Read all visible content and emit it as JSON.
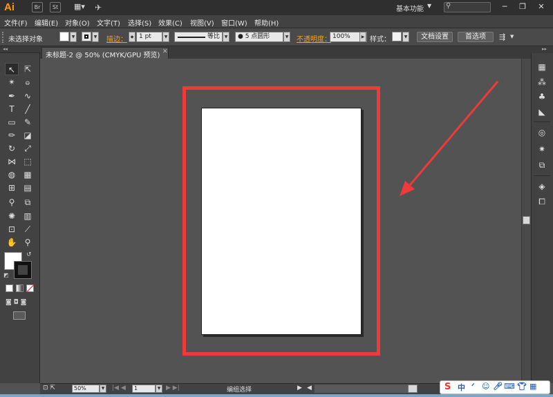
{
  "app": {
    "logo": "Ai"
  },
  "titlebar": {
    "workspace": "基本功能",
    "workspace_arrow": "▼",
    "btn_br": "Br",
    "btn_st": "St",
    "btn_layout": "▦▾",
    "minimize": "─",
    "restore": "❐",
    "close": "✕"
  },
  "menu": [
    "文件(F)",
    "编辑(E)",
    "对象(O)",
    "文字(T)",
    "选择(S)",
    "效果(C)",
    "视图(V)",
    "窗口(W)",
    "帮助(H)"
  ],
  "control": {
    "selection_status": "未选择对象",
    "stroke_label": "描边：",
    "stroke_weight": "1 pt",
    "stroke_profile": "等比",
    "brush": "5 点圆形",
    "opacity_label": "不透明度：",
    "opacity_value": "100%",
    "style_label": "样式：",
    "doc_setup": "文档设置",
    "preferences": "首选项"
  },
  "document": {
    "tab_title": "未标题-2 @ 50% (CMYK/GPU 预览)",
    "close": "✕"
  },
  "statusbar": {
    "zoom": "50%",
    "artboard": "1",
    "tool_status": "编组选择"
  },
  "tools": [
    [
      "selection-tool",
      "↖"
    ],
    [
      "direct-selection-tool",
      "⇱"
    ],
    [
      "magic-wand-tool",
      "✴"
    ],
    [
      "lasso-tool",
      "ဓ"
    ],
    [
      "pen-tool",
      "✒"
    ],
    [
      "curvature-tool",
      "∿"
    ],
    [
      "type-tool",
      "T"
    ],
    [
      "line-tool",
      "╱"
    ],
    [
      "rectangle-tool",
      "▭"
    ],
    [
      "paintbrush-tool",
      "✎"
    ],
    [
      "pencil-tool",
      "✏"
    ],
    [
      "eraser-tool",
      "◪"
    ],
    [
      "rotate-tool",
      "↻"
    ],
    [
      "scale-tool",
      "⤢"
    ],
    [
      "width-tool",
      "⋈"
    ],
    [
      "free-transform-tool",
      "⬚"
    ],
    [
      "shape-builder-tool",
      "◍"
    ],
    [
      "perspective-grid-tool",
      "▦"
    ],
    [
      "mesh-tool",
      "⊞"
    ],
    [
      "gradient-tool",
      "▤"
    ],
    [
      "eyedropper-tool",
      "⚲"
    ],
    [
      "blend-tool",
      "⧉"
    ],
    [
      "symbol-sprayer-tool",
      "✺"
    ],
    [
      "column-graph-tool",
      "▥"
    ],
    [
      "artboard-tool",
      "⊡"
    ],
    [
      "slice-tool",
      "⟋"
    ],
    [
      "hand-tool",
      "✋"
    ],
    [
      "zoom-tool",
      "⚲"
    ]
  ],
  "right_icons": [
    "▦",
    "⁂",
    "♣",
    "◣",
    "◎",
    "✷",
    "⧉",
    "◈",
    "⧠"
  ],
  "ime": {
    "s_logo": "S",
    "lang": "中"
  }
}
